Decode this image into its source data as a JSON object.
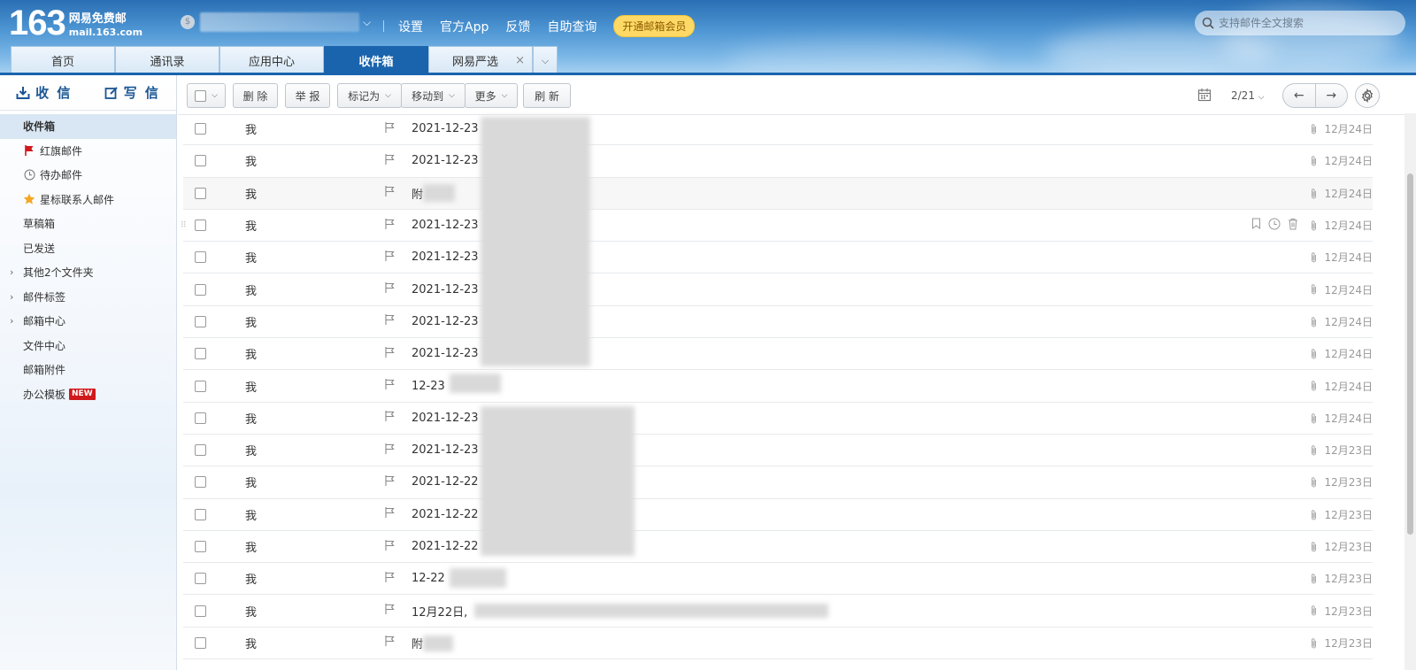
{
  "logo": {
    "number": "163",
    "cn": "网易免费邮",
    "domain": "mail.163.com"
  },
  "top_links": [
    "设置",
    "官方App",
    "反馈",
    "自助查询"
  ],
  "vip_button": "开通邮箱会员",
  "search": {
    "placeholder": "支持邮件全文搜索"
  },
  "tabs": [
    {
      "label": "首页",
      "active": false
    },
    {
      "label": "通讯录",
      "active": false
    },
    {
      "label": "应用中心",
      "active": false
    },
    {
      "label": "收件箱",
      "active": true
    },
    {
      "label": "网易严选",
      "active": false,
      "closable": true
    }
  ],
  "sidebar": {
    "receive_label": "收 信",
    "write_label": "写 信",
    "folders": [
      {
        "label": "收件箱",
        "active": true
      },
      {
        "label": "红旗邮件",
        "icon": "red-flag-icon"
      },
      {
        "label": "待办邮件",
        "icon": "clock-icon"
      },
      {
        "label": "星标联系人邮件",
        "icon": "star-icon"
      },
      {
        "label": "草稿箱"
      },
      {
        "label": "已发送"
      },
      {
        "label": "其他2个文件夹",
        "expandable": true
      },
      {
        "label": "邮件标签",
        "expandable": true
      },
      {
        "label": "邮箱中心",
        "expandable": true
      },
      {
        "label": "文件中心"
      },
      {
        "label": "邮箱附件"
      },
      {
        "label": "办公模板",
        "badge": "NEW"
      }
    ]
  },
  "toolbar": {
    "delete": "删 除",
    "report": "举 报",
    "mark_as": "标记为",
    "move_to": "移动到",
    "more": "更多",
    "refresh": "刷 新",
    "page": "2/21"
  },
  "mails": [
    {
      "from": "我",
      "subject": "2021-12-23",
      "date": "12月24日"
    },
    {
      "from": "我",
      "subject": "2021-12-23",
      "date": "12月24日"
    },
    {
      "from": "我",
      "subject": "附",
      "date": "12月24日"
    },
    {
      "from": "我",
      "subject": "2021-12-23",
      "date": "12月24日"
    },
    {
      "from": "我",
      "subject": "2021-12-23",
      "date": "12月24日"
    },
    {
      "from": "我",
      "subject": "2021-12-23",
      "date": "12月24日"
    },
    {
      "from": "我",
      "subject": "2021-12-23",
      "date": "12月24日"
    },
    {
      "from": "我",
      "subject": "2021-12-23",
      "date": "12月24日"
    },
    {
      "from": "我",
      "subject": "12-23",
      "date": "12月24日"
    },
    {
      "from": "我",
      "subject": "2021-12-23",
      "date": "12月24日"
    },
    {
      "from": "我",
      "subject": "2021-12-23",
      "date": "12月23日"
    },
    {
      "from": "我",
      "subject": "2021-12-22",
      "date": "12月23日"
    },
    {
      "from": "我",
      "subject": "2021-12-22",
      "date": "12月23日"
    },
    {
      "from": "我",
      "subject": "2021-12-22",
      "date": "12月23日"
    },
    {
      "from": "我",
      "subject": "12-22",
      "date": "12月23日"
    },
    {
      "from": "我",
      "subject": "12月22日,",
      "date": "12月23日"
    },
    {
      "from": "我",
      "subject": "附",
      "date": "12月23日"
    }
  ],
  "colors": {
    "brand_blue": "#1a64ad",
    "vip_yellow": "#ffd966",
    "flag_red": "#d0191c"
  }
}
